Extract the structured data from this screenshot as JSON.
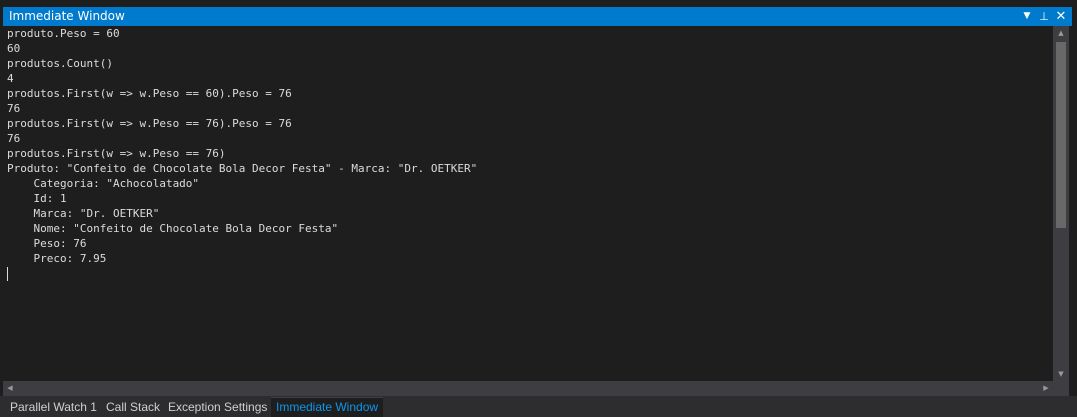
{
  "window": {
    "title": "Immediate Window",
    "buttons": {
      "dropdown": "▼",
      "pin": "⊥",
      "close": "✕"
    }
  },
  "output_lines": [
    "produto.Peso = 60",
    "60",
    "produtos.Count()",
    "4",
    "produtos.First(w => w.Peso == 60).Peso = 76",
    "76",
    "produtos.First(w => w.Peso == 76).Peso = 76",
    "76",
    "produtos.First(w => w.Peso == 76)",
    "Produto: \"Confeito de Chocolate Bola Decor Festa\" - Marca: \"Dr. OETKER\"",
    "    Categoria: \"Achocolatado\"",
    "    Id: 1",
    "    Marca: \"Dr. OETKER\"",
    "    Nome: \"Confeito de Chocolate Bola Decor Festa\"",
    "    Peso: 76",
    "    Preco: 7.95"
  ],
  "tabs": [
    {
      "label": "Parallel Watch 1"
    },
    {
      "label": "Call Stack"
    },
    {
      "label": "Exception Settings"
    },
    {
      "label": "Immediate Window",
      "active": true
    }
  ],
  "colors": {
    "titlebar": "#007acc",
    "editor_bg": "#1e1e1e",
    "text": "#dcdcdc",
    "active_tab_text": "#0e97ea"
  }
}
